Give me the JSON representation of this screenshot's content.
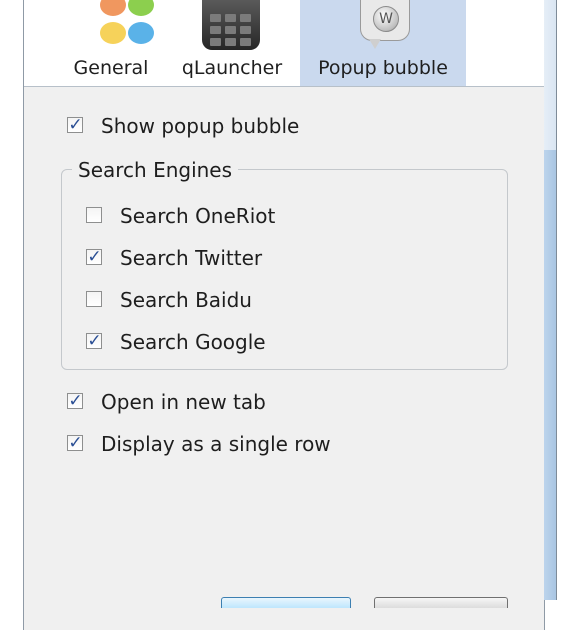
{
  "tabs": [
    {
      "id": "general",
      "label": "General",
      "icon": "colorful-blobs-icon",
      "active": false
    },
    {
      "id": "qlauncher",
      "label": "qLauncher",
      "icon": "calculator-icon",
      "active": false
    },
    {
      "id": "popup",
      "label": "Popup bubble",
      "icon": "wikipedia-bubble-icon",
      "active": true
    }
  ],
  "options": {
    "show_popup_bubble": {
      "label": "Show popup bubble",
      "checked": true
    },
    "open_in_new_tab": {
      "label": "Open in new tab",
      "checked": true
    },
    "display_single_row": {
      "label": "Display as a single row",
      "checked": true
    }
  },
  "search_engines": {
    "title": "Search Engines",
    "items": [
      {
        "label": "Search OneRiot",
        "checked": false
      },
      {
        "label": "Search Twitter",
        "checked": true
      },
      {
        "label": "Search Baidu",
        "checked": false
      },
      {
        "label": "Search Google",
        "checked": true
      }
    ]
  },
  "check_glyph": "✓",
  "colors": {
    "active_tab_bg": "#cad9ee",
    "dialog_bg": "#f0f0f0",
    "check_mark": "#2a4e94"
  }
}
